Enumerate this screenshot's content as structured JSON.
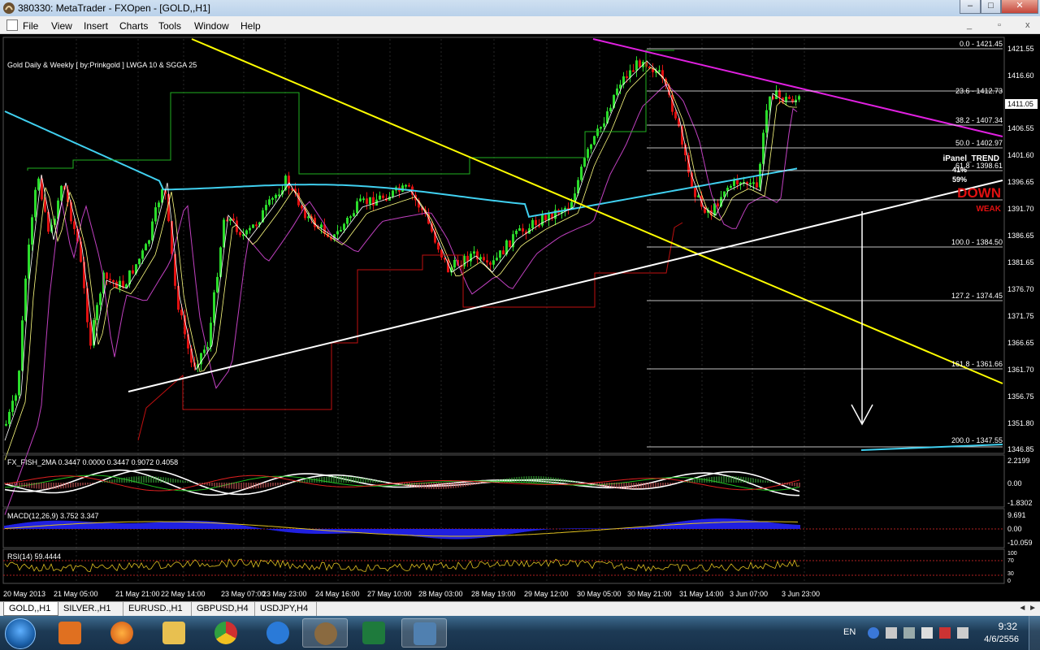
{
  "window": {
    "title": "380330: MetaTrader - FXOpen - [GOLD,,H1]",
    "minimize": "–",
    "maximize": "□",
    "close": "✕"
  },
  "menu": [
    "File",
    "View",
    "Insert",
    "Charts",
    "Tools",
    "Window",
    "Help"
  ],
  "chart": {
    "caption": "Gold Daily & Weekly [ by:Prinkgold ]  LWGA 10  &  SGGA 25",
    "current_price": "1411.05",
    "price_labels": [
      "1421.55",
      "1416.60",
      "1411.05",
      "1406.55",
      "1401.60",
      "1396.65",
      "1391.70",
      "1386.65",
      "1381.65",
      "1376.70",
      "1371.75",
      "1366.65",
      "1361.70",
      "1356.75",
      "1351.80",
      "1346.85"
    ],
    "time_labels": [
      "20 May 2013",
      "21 May 05:00",
      "21 May 21:00",
      "22 May 14:00",
      "23 May 07:00",
      "23 May 23:00",
      "24 May 16:00",
      "27 May 10:00",
      "28 May 03:00",
      "28 May 19:00",
      "29 May 12:00",
      "30 May 05:00",
      "30 May 21:00",
      "31 May 14:00",
      "3 Jun 07:00",
      "3 Jun 23:00"
    ],
    "fib_levels": [
      {
        "label": "0.0 - 1421.45"
      },
      {
        "label": "23.6 - 1412.73"
      },
      {
        "label": "38.2 - 1407.34"
      },
      {
        "label": "50.0 - 1402.97"
      },
      {
        "label": "61.8 - 1398.61"
      },
      {
        "label": "100.0 - 1384.50"
      },
      {
        "label": "127.2 - 1374.45"
      },
      {
        "label": "161.8 - 1361.66"
      },
      {
        "label": "200.0 - 1347.55"
      }
    ],
    "ipanel": {
      "title": "iPanel_TREND",
      "pct1": "41%",
      "pct2": "59%",
      "state": "DOWN",
      "strength": "WEAK"
    },
    "colors": {
      "bull": "#2bdc2b",
      "bear": "#e01010",
      "fib": "#ffffff",
      "trend_yellow": "#ffff00",
      "trend_magenta": "#e020e0",
      "ma_cyan": "#40d0f0"
    }
  },
  "indicators": {
    "fish": {
      "label": "FX_FISH_2MA 0.3447 0.0000 0.3447 0.9072 0.4058",
      "scale": [
        "2.2199",
        "0.00",
        "-1.8302"
      ]
    },
    "macd": {
      "label": "MACD(12,26,9) 3.752 3.347",
      "scale": [
        "9.691",
        "0.00",
        "-10.059"
      ]
    },
    "rsi": {
      "label": "RSI(14) 59.4444",
      "scale": [
        "100",
        "70",
        "30",
        "0"
      ]
    }
  },
  "tabs": [
    "GOLD,,H1",
    "SILVER.,H1",
    "EURUSD.,H1",
    "GBPUSD,H4",
    "USDJPY,H4"
  ],
  "taskbar": {
    "apps": [
      {
        "name": "media-player",
        "color": "#e07020"
      },
      {
        "name": "firefox",
        "color": "#e86a10"
      },
      {
        "name": "explorer",
        "color": "#e8c050"
      },
      {
        "name": "chrome",
        "color": "#d03030"
      },
      {
        "name": "ie",
        "color": "#2a7ad8"
      },
      {
        "name": "metatrader-bull",
        "color": "#8a6a40"
      },
      {
        "name": "excel",
        "color": "#1e7a3c"
      },
      {
        "name": "metatrader",
        "color": "#5080b0"
      }
    ],
    "lang": "EN",
    "time": "9:32",
    "date": "4/6/2556"
  }
}
